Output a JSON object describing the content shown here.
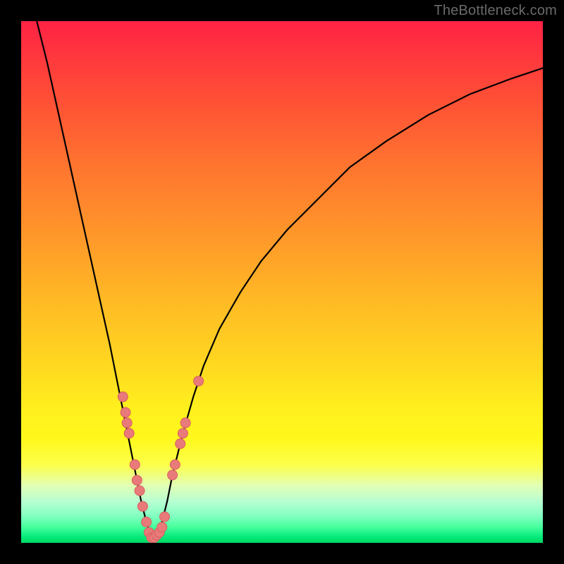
{
  "watermark": "TheBottleneck.com",
  "colors": {
    "dot_fill": "#e97a7a",
    "dot_stroke": "#d85f5f",
    "curve": "#000000"
  },
  "chart_data": {
    "type": "line",
    "title": "",
    "xlabel": "",
    "ylabel": "",
    "xlim": [
      0,
      100
    ],
    "ylim": [
      0,
      100
    ],
    "x_optimum": 25,
    "series": [
      {
        "name": "bottleneck-curve",
        "x": [
          3,
          5,
          7,
          9,
          11,
          13,
          15,
          17,
          19,
          20,
          21,
          22,
          23,
          24,
          25,
          26,
          27,
          28,
          29,
          31,
          33,
          35,
          38,
          42,
          46,
          51,
          57,
          63,
          70,
          78,
          86,
          94,
          100
        ],
        "y": [
          100,
          92,
          83,
          74,
          65,
          56,
          47,
          38,
          28,
          23,
          18,
          13,
          8,
          4,
          1,
          1,
          4,
          8,
          13,
          21,
          28,
          34,
          41,
          48,
          54,
          60,
          66,
          72,
          77,
          82,
          86,
          89,
          91
        ]
      }
    ],
    "markers": [
      {
        "x": 19.5,
        "y": 28
      },
      {
        "x": 20.0,
        "y": 25
      },
      {
        "x": 20.3,
        "y": 23
      },
      {
        "x": 20.7,
        "y": 21
      },
      {
        "x": 21.8,
        "y": 15
      },
      {
        "x": 22.2,
        "y": 12
      },
      {
        "x": 22.7,
        "y": 10
      },
      {
        "x": 23.3,
        "y": 7
      },
      {
        "x": 24.0,
        "y": 4
      },
      {
        "x": 24.5,
        "y": 2
      },
      {
        "x": 25.0,
        "y": 1
      },
      {
        "x": 25.5,
        "y": 1
      },
      {
        "x": 26.0,
        "y": 1.5
      },
      {
        "x": 26.5,
        "y": 2
      },
      {
        "x": 27.0,
        "y": 3
      },
      {
        "x": 27.5,
        "y": 5
      },
      {
        "x": 29.0,
        "y": 13
      },
      {
        "x": 29.5,
        "y": 15
      },
      {
        "x": 30.5,
        "y": 19
      },
      {
        "x": 31.0,
        "y": 21
      },
      {
        "x": 31.5,
        "y": 23
      },
      {
        "x": 34.0,
        "y": 31
      }
    ]
  }
}
